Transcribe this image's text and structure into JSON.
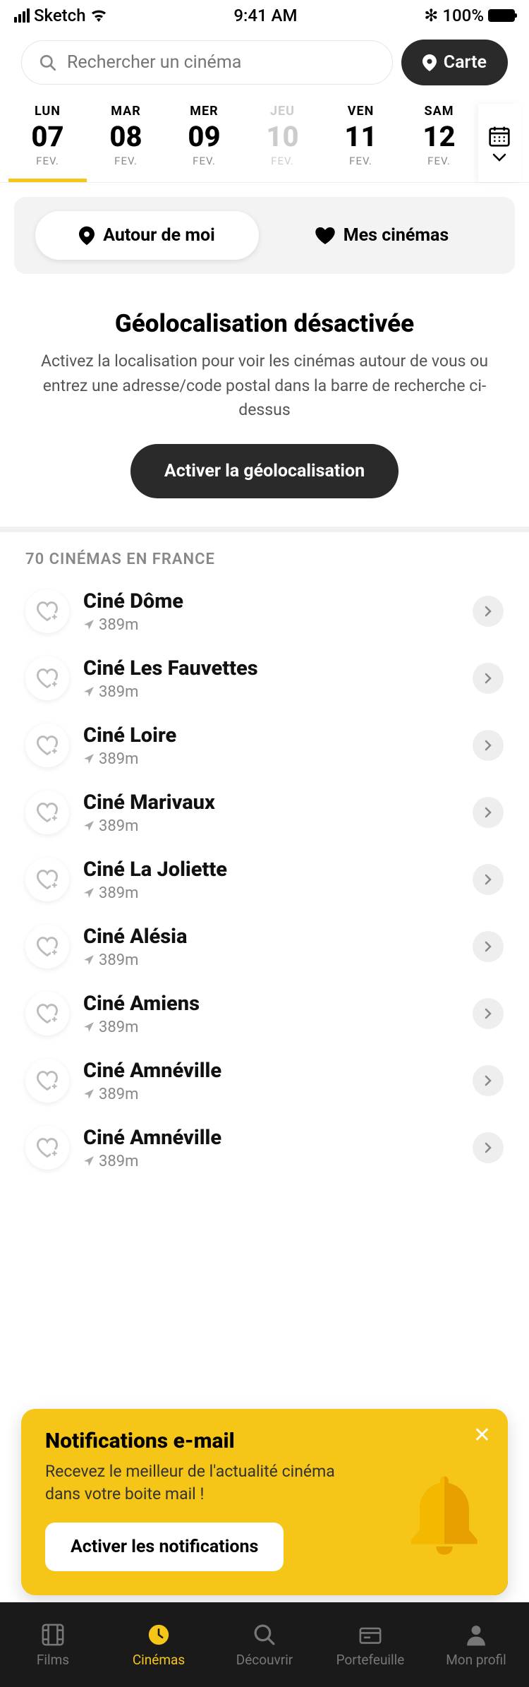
{
  "status": {
    "carrier": "Sketch",
    "time": "9:41 AM",
    "battery": "100%"
  },
  "search": {
    "placeholder": "Rechercher un cinéma",
    "map_btn": "Carte"
  },
  "dates": [
    {
      "day": "LUN",
      "num": "07",
      "month": "FEV.",
      "active": true
    },
    {
      "day": "MAR",
      "num": "08",
      "month": "FEV."
    },
    {
      "day": "MER",
      "num": "09",
      "month": "FEV."
    },
    {
      "day": "JEU",
      "num": "10",
      "month": "FEV.",
      "disabled": true
    },
    {
      "day": "VEN",
      "num": "11",
      "month": "FEV."
    },
    {
      "day": "SAM",
      "num": "12",
      "month": "FEV."
    }
  ],
  "filters": {
    "around": "Autour de moi",
    "mine": "Mes cinémas"
  },
  "geo": {
    "title": "Géolocalisation désactivée",
    "text": "Activez la localisation pour voir les cinémas autour de vous ou entrez une adresse/code postal dans la barre de recherche ci-dessus",
    "btn": "Activer la géolocalisation"
  },
  "list_header": "70 CINÉMAS EN FRANCE",
  "cinemas": [
    {
      "name": "Ciné Dôme",
      "dist": "389m"
    },
    {
      "name": "Ciné Les Fauvettes",
      "dist": "389m"
    },
    {
      "name": "Ciné Loire",
      "dist": "389m"
    },
    {
      "name": "Ciné Marivaux",
      "dist": "389m"
    },
    {
      "name": "Ciné La Joliette",
      "dist": "389m"
    },
    {
      "name": "Ciné Alésia",
      "dist": "389m"
    },
    {
      "name": "Ciné Amiens",
      "dist": "389m"
    },
    {
      "name": "Ciné Amnéville",
      "dist": "389m"
    },
    {
      "name": "Ciné Amnéville",
      "dist": "389m"
    }
  ],
  "notif": {
    "title": "Notifications e-mail",
    "text": "Recevez le meilleur de l'actualité cinéma dans votre boite mail !",
    "btn": "Activer les notifications"
  },
  "tabs": [
    {
      "label": "Films"
    },
    {
      "label": "Cinémas",
      "active": true
    },
    {
      "label": "Découvrir"
    },
    {
      "label": "Portefeuille"
    },
    {
      "label": "Mon profil"
    }
  ]
}
